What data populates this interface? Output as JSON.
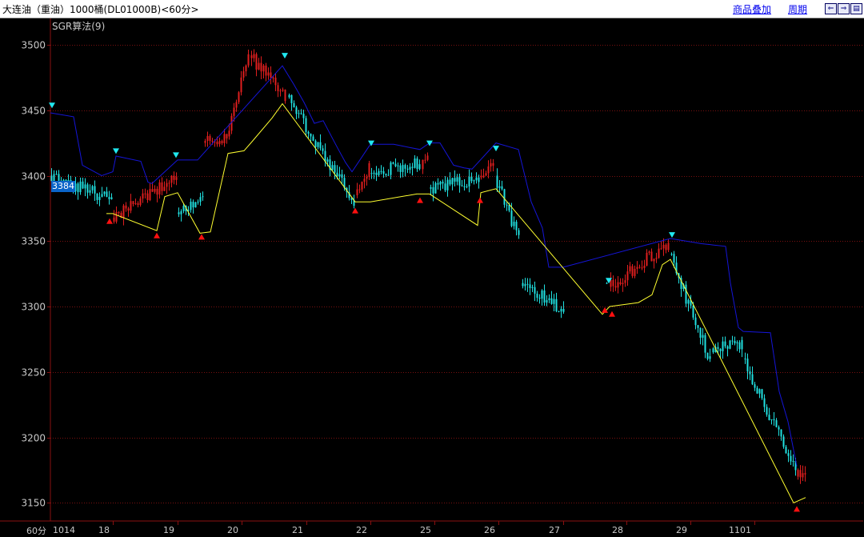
{
  "header": {
    "title": "大连油（重油）1000桶(DL01000B)<60分>",
    "overlay_link": "商品叠加",
    "cycle_link": "周期",
    "nav_buttons": [
      "⇐",
      "⇒",
      "▤"
    ]
  },
  "indicator_label": "SGR算法(9)",
  "last_price_badge": "3384",
  "period_label": "60分",
  "colors": {
    "up": "#e01e1e",
    "down": "#20e0e0",
    "buy_line": "#ffff30",
    "sell_line": "#1515d8",
    "grid": "#7a1010",
    "axis": "#8a1010",
    "text": "#c8c8c8"
  },
  "chart_data": {
    "type": "candlestick",
    "title": "SGR算法(9)",
    "ylim": [
      3135,
      3515
    ],
    "y_ticks": [
      3150,
      3200,
      3250,
      3300,
      3350,
      3400,
      3450,
      3500
    ],
    "x_tick_labels": [
      "1014",
      "18",
      "19",
      "20",
      "21",
      "22",
      "25",
      "26",
      "27",
      "28",
      "29",
      "1101"
    ],
    "segments": [
      {
        "x0": 63,
        "x1": 141,
        "start": 3400,
        "end": 3382,
        "low": 3376,
        "high": 3424,
        "trend": "down"
      },
      {
        "x0": 141,
        "x1": 222,
        "start": 3368,
        "end": 3400,
        "low": 3343,
        "high": 3414,
        "trend": "up"
      },
      {
        "x0": 222,
        "x1": 255,
        "start": 3372,
        "end": 3380,
        "low": 3365,
        "high": 3392,
        "trend": "down"
      },
      {
        "x0": 255,
        "x1": 285,
        "start": 3425,
        "end": 3428,
        "low": 3422,
        "high": 3440,
        "trend": "up"
      },
      {
        "x0": 285,
        "x1": 313,
        "start": 3430,
        "end": 3495,
        "low": 3425,
        "high": 3502,
        "trend": "up"
      },
      {
        "x0": 313,
        "x1": 360,
        "start": 3492,
        "end": 3462,
        "low": 3455,
        "high": 3502,
        "trend": "up"
      },
      {
        "x0": 360,
        "x1": 445,
        "start": 3460,
        "end": 3380,
        "low": 3375,
        "high": 3466,
        "trend": "down"
      },
      {
        "x0": 445,
        "x1": 463,
        "start": 3385,
        "end": 3405,
        "low": 3378,
        "high": 3420,
        "trend": "up"
      },
      {
        "x0": 463,
        "x1": 527,
        "start": 3402,
        "end": 3410,
        "low": 3385,
        "high": 3424,
        "trend": "down"
      },
      {
        "x0": 527,
        "x1": 537,
        "start": 3405,
        "end": 3420,
        "low": 3400,
        "high": 3425,
        "trend": "up"
      },
      {
        "x0": 537,
        "x1": 600,
        "start": 3390,
        "end": 3398,
        "low": 3336,
        "high": 3408,
        "trend": "down"
      },
      {
        "x0": 600,
        "x1": 620,
        "start": 3400,
        "end": 3410,
        "low": 3390,
        "high": 3423,
        "trend": "up"
      },
      {
        "x0": 620,
        "x1": 650,
        "start": 3400,
        "end": 3350,
        "low": 3344,
        "high": 3410,
        "trend": "down"
      },
      {
        "x0": 652,
        "x1": 707,
        "start": 3318,
        "end": 3298,
        "low": 3290,
        "high": 3330,
        "trend": "down"
      },
      {
        "x0": 757,
        "x1": 762,
        "start": 3318,
        "end": 3322,
        "low": 3298,
        "high": 3326,
        "trend": "down"
      },
      {
        "x0": 762,
        "x1": 838,
        "start": 3315,
        "end": 3348,
        "low": 3310,
        "high": 3367,
        "trend": "up"
      },
      {
        "x0": 838,
        "x1": 890,
        "start": 3340,
        "end": 3260,
        "low": 3255,
        "high": 3350,
        "trend": "down"
      },
      {
        "x0": 890,
        "x1": 930,
        "start": 3268,
        "end": 3270,
        "low": 3260,
        "high": 3283,
        "trend": "down"
      },
      {
        "x0": 930,
        "x1": 996,
        "start": 3260,
        "end": 3175,
        "low": 3145,
        "high": 3270,
        "trend": "down"
      },
      {
        "x0": 996,
        "x1": 1008,
        "start": 3170,
        "end": 3175,
        "low": 3162,
        "high": 3185,
        "trend": "up"
      }
    ],
    "resistance_line": [
      [
        63,
        3448
      ],
      [
        92,
        3445
      ],
      [
        103,
        3408
      ],
      [
        127,
        3400
      ],
      [
        141,
        3403
      ],
      [
        145,
        3415
      ],
      [
        176,
        3411
      ],
      [
        185,
        3395
      ],
      [
        190,
        3394
      ],
      [
        222,
        3412
      ],
      [
        247,
        3412
      ],
      [
        353,
        3484
      ],
      [
        360,
        3477
      ],
      [
        367,
        3470
      ],
      [
        380,
        3456
      ],
      [
        393,
        3440
      ],
      [
        404,
        3442
      ],
      [
        416,
        3428
      ],
      [
        423,
        3420
      ],
      [
        432,
        3410
      ],
      [
        440,
        3403
      ],
      [
        463,
        3424
      ],
      [
        492,
        3424
      ],
      [
        525,
        3420
      ],
      [
        537,
        3425
      ],
      [
        550,
        3425
      ],
      [
        567,
        3408
      ],
      [
        580,
        3406
      ],
      [
        590,
        3405
      ],
      [
        620,
        3425
      ],
      [
        648,
        3420
      ],
      [
        664,
        3380
      ],
      [
        678,
        3360
      ],
      [
        686,
        3330
      ],
      [
        704,
        3330
      ],
      [
        838,
        3352
      ],
      [
        877,
        3348
      ],
      [
        907,
        3346
      ],
      [
        913,
        3318
      ],
      [
        923,
        3284
      ],
      [
        929,
        3281
      ],
      [
        963,
        3280
      ],
      [
        974,
        3235
      ],
      [
        985,
        3212
      ],
      [
        996,
        3178
      ]
    ],
    "support_line": [
      [
        133,
        3371
      ],
      [
        141,
        3371
      ],
      [
        196,
        3358
      ],
      [
        206,
        3384
      ],
      [
        222,
        3387
      ],
      [
        250,
        3356
      ],
      [
        263,
        3357
      ],
      [
        285,
        3417
      ],
      [
        305,
        3419
      ],
      [
        315,
        3426
      ],
      [
        340,
        3444
      ],
      [
        353,
        3455
      ],
      [
        444,
        3380
      ],
      [
        463,
        3380
      ],
      [
        521,
        3386
      ],
      [
        537,
        3386
      ],
      [
        597,
        3362
      ],
      [
        601,
        3387
      ],
      [
        620,
        3390
      ],
      [
        753,
        3294
      ],
      [
        762,
        3300
      ],
      [
        798,
        3303
      ],
      [
        815,
        3309
      ],
      [
        828,
        3332
      ],
      [
        838,
        3336
      ],
      [
        992,
        3150
      ],
      [
        1007,
        3154
      ]
    ],
    "buy_signals": [
      [
        137,
        3365
      ],
      [
        196,
        3354
      ],
      [
        252,
        3353
      ],
      [
        444,
        3373
      ],
      [
        525,
        3381
      ],
      [
        600,
        3381
      ],
      [
        756,
        3297
      ],
      [
        765,
        3294
      ],
      [
        996,
        3145
      ]
    ],
    "sell_signals": [
      [
        65,
        3454
      ],
      [
        145,
        3419
      ],
      [
        220,
        3416
      ],
      [
        356,
        3492
      ],
      [
        464,
        3425
      ],
      [
        537,
        3425
      ],
      [
        620,
        3421
      ],
      [
        761,
        3320
      ],
      [
        840,
        3355
      ]
    ]
  }
}
